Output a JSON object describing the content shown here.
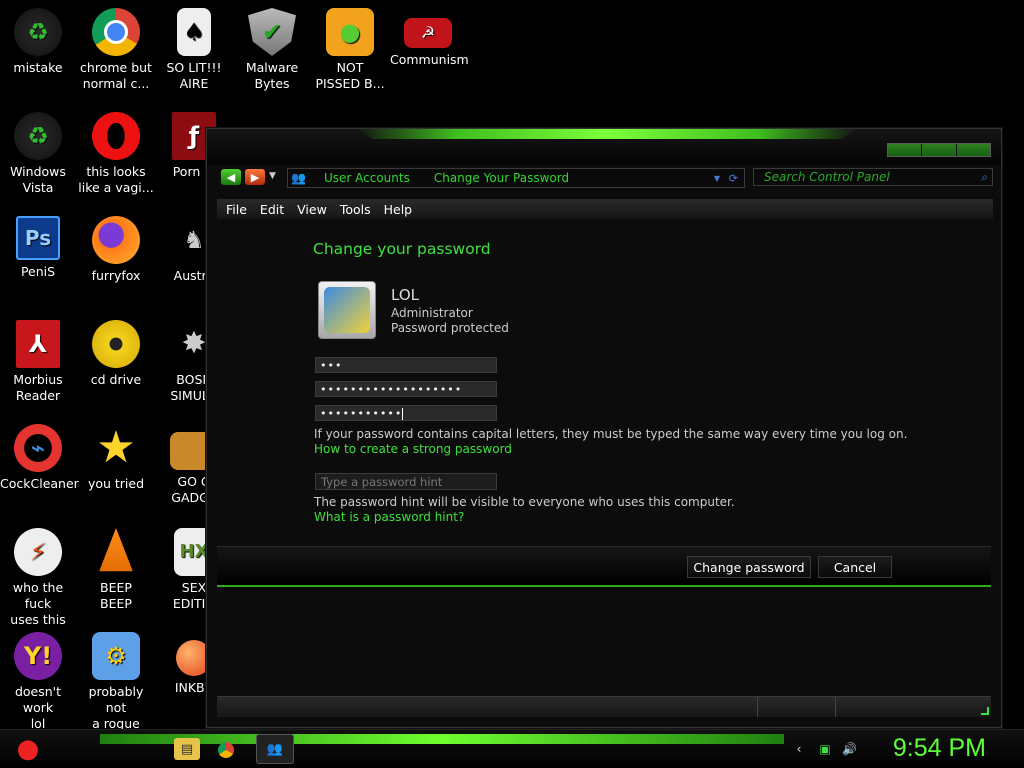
{
  "desktop": {
    "icons": [
      {
        "label": "mistake"
      },
      {
        "label": "chrome but\nnormal c..."
      },
      {
        "label": "SO LIT!!!\nAIRE"
      },
      {
        "label": "Malware\nBytes"
      },
      {
        "label": "NOT\nPISSED B..."
      },
      {
        "label": "Communism"
      },
      {
        "label": "Windows\nVista"
      },
      {
        "label": "this looks\nlike a vagi..."
      },
      {
        "label": "Porn Pl"
      },
      {
        "label": "PeniS"
      },
      {
        "label": "furryfox"
      },
      {
        "label": "Austra"
      },
      {
        "label": "Morbius\nReader"
      },
      {
        "label": "cd drive"
      },
      {
        "label": "BOSN\nSIMULA"
      },
      {
        "label": "CockCleaner"
      },
      {
        "label": "you tried"
      },
      {
        "label": "GO G\nGADGE"
      },
      {
        "label": "who the fuck\nuses this"
      },
      {
        "label": "BEEP\nBEEP"
      },
      {
        "label": "SEX\nEDITIO"
      },
      {
        "label": "doesn't work\nlol"
      },
      {
        "label": "probably not\na rogue"
      },
      {
        "label": "INKBA"
      }
    ]
  },
  "window": {
    "address": {
      "crumb1": "User Accounts",
      "crumb2": "Change Your Password"
    },
    "search_placeholder": "Search Control Panel",
    "menu": [
      "File",
      "Edit",
      "View",
      "Tools",
      "Help"
    ],
    "title": "Change your password",
    "user": {
      "name": "LOL",
      "role": "Administrator",
      "status": "Password protected"
    },
    "fields": {
      "current": "•••",
      "new": "•••••••••••••••••••",
      "confirm": "•••••••••••"
    },
    "capital_note": "If your password contains capital letters, they must be typed the same way every time you log on.",
    "strong_link": "How to create a strong password",
    "hint_placeholder": "Type a password hint",
    "hint_note": "The password hint will be visible to everyone who uses this computer.",
    "hint_link": "What is a password hint?",
    "buttons": {
      "change": "Change password",
      "cancel": "Cancel"
    }
  },
  "taskbar": {
    "clock": "9:54 PM"
  },
  "colors": {
    "accent": "#3ee03e",
    "glow": "#6fff2f"
  }
}
